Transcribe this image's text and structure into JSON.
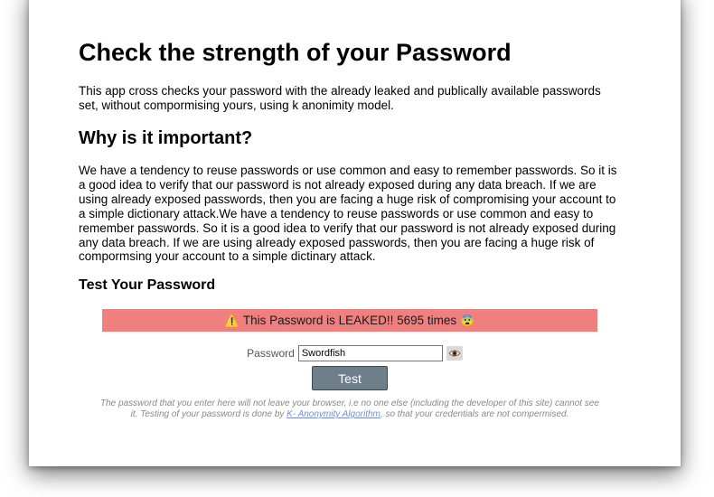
{
  "page": {
    "title": "Check the strength of your Password",
    "intro": "This app cross checks your password with the already leaked and publically available passwords set, without compormising yours, using k anonimity model."
  },
  "why": {
    "heading": "Why is it important?",
    "body": "We have a tendency to reuse passwords or use common and easy to remember passwords. So it is a good idea to verify that our password is not already exposed during any data breach. If we are using already exposed passwords, then you are facing a huge risk of compromising your account to a simple dictionary attack.We have a tendency to reuse passwords or use common and easy to remember passwords. So it is a good idea to verify that our password is not already exposed during any data breach. If we are using already exposed passwords, then you are facing a huge risk of compormsing your account to a simple dictinary attack."
  },
  "test": {
    "heading": "Test Your Password",
    "alert_icon": "⚠️",
    "alert_text": "This Password is LEAKED!! 5695 times",
    "alert_emoji": "😨",
    "alert_color": "#f08080",
    "password_label": "Password",
    "password_value": "Swordfish",
    "toggle_icon": "eye-icon",
    "button_label": "Test",
    "note_before": "The password that you enter here will not leave your browser, i.e no one else (including the developer of this site) cannot see it. Testing of your password is done by ",
    "note_link": "K- Anonymity Algorithm",
    "note_after": ", so that your credentials are not compermised."
  }
}
